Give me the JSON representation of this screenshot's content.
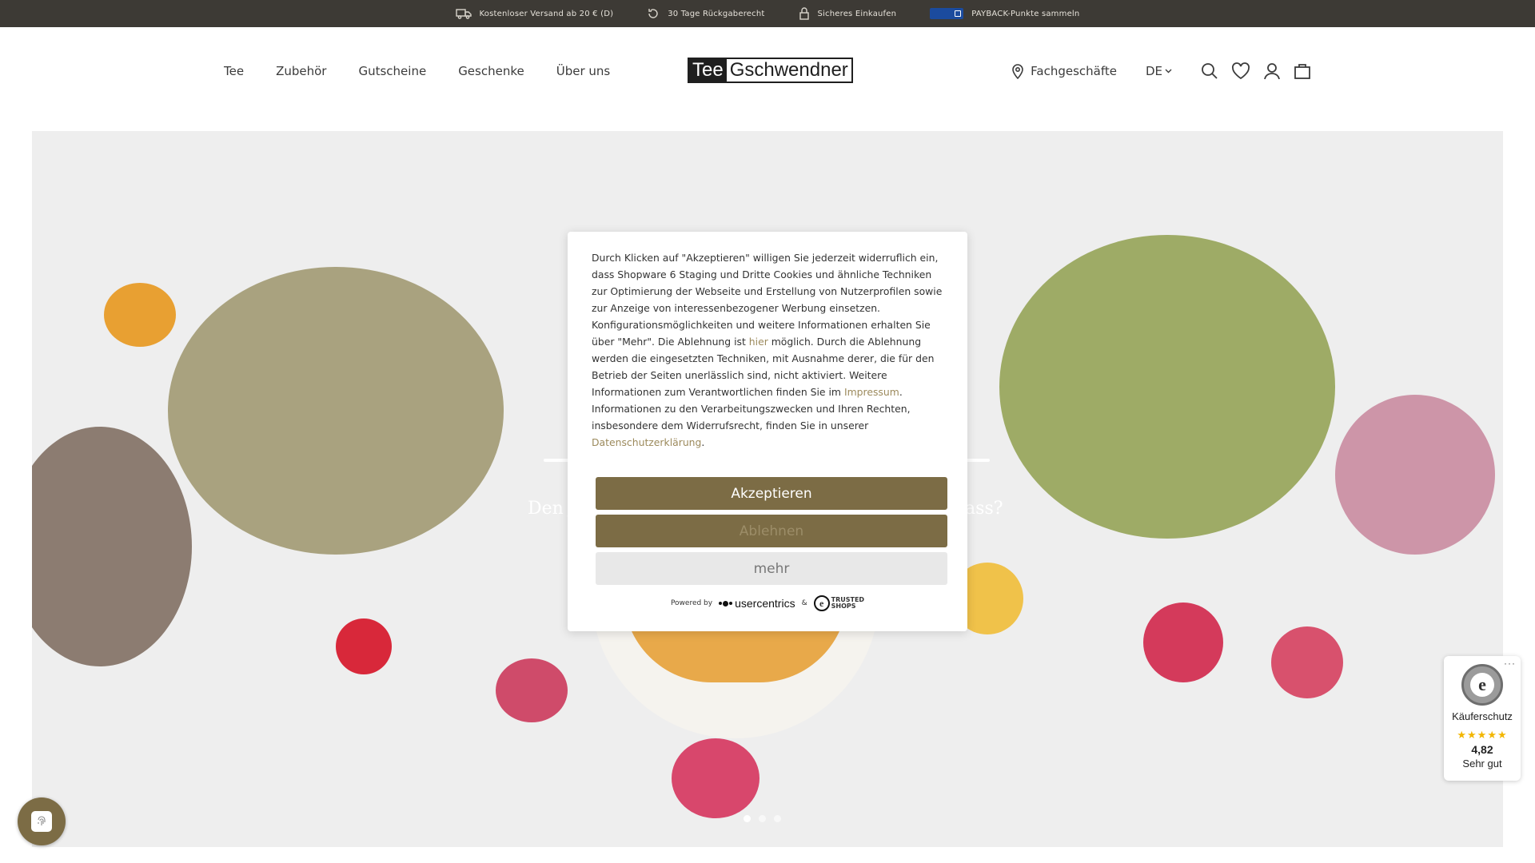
{
  "topbar": {
    "usps": [
      {
        "icon": "truck-icon",
        "label": "Kostenloser Versand ab 20 € (D)"
      },
      {
        "icon": "return-icon",
        "label": "30 Tage Rückgaberecht"
      },
      {
        "icon": "lock-icon",
        "label": "Sicheres Einkaufen"
      },
      {
        "icon": "payback-logo",
        "label": "PAYBACK-Punkte sammeln"
      }
    ]
  },
  "nav": {
    "items": [
      "Tee",
      "Zubehör",
      "Gutscheine",
      "Geschenke",
      "Über uns"
    ]
  },
  "logo": {
    "part1": "Tee",
    "part2": "Gschwendner"
  },
  "header_right": {
    "stores_label": "Fachgeschäfte",
    "language": "DE",
    "icons": [
      "search-icon",
      "heart-icon",
      "user-icon",
      "cart-icon"
    ]
  },
  "hero": {
    "subtitle_left": "Den j",
    "subtitle_right": "lass?",
    "slides": 3,
    "active_slide": 1
  },
  "cookie_banner": {
    "text_1": "Durch Klicken auf \"Akzeptieren\" willigen Sie jederzeit widerruflich ein, dass Shopware 6 Staging und Dritte Cookies und ähnliche Techniken zur Optimierung der Webseite und Erstellung von Nutzerprofilen sowie zur Anzeige von interessenbezogener Werbung einsetzen. Konfigurationsmöglichkeiten und weitere Informationen erhalten Sie über \"Mehr\". Die Ablehnung ist ",
    "link_here": "hier",
    "text_2": " möglich. Durch die Ablehnung werden die eingesetzten Techniken, mit Ausnahme derer, die für den Betrieb der Seiten unerlässlich sind, nicht aktiviert. Weitere Informationen zum Verantwortlichen finden Sie im ",
    "link_imprint": "Impressum",
    "text_3": ". Informationen zu den Verarbeitungszwecken und Ihren Rechten, insbesondere dem Widerrufsrecht, finden Sie in unserer ",
    "link_privacy": "Datenschutzerklärung",
    "text_4": ".",
    "accept_label": "Akzeptieren",
    "deny_label": "Ablehnen",
    "more_label": "mehr",
    "powered_by": "Powered by",
    "usercentrics": "usercentrics",
    "ampersand": "&",
    "trusted_shops_line1": "TRUSTED",
    "trusted_shops_line2": "SHOPS"
  },
  "trusted_badge": {
    "more": "···",
    "seal_letter": "e",
    "label": "Käuferschutz",
    "stars": "★★★★★",
    "score": "4,82",
    "grade": "Sehr gut"
  },
  "colors": {
    "topbar_bg": "#3d3a35",
    "accent": "#7c6c45",
    "link": "#9c8a5c"
  }
}
